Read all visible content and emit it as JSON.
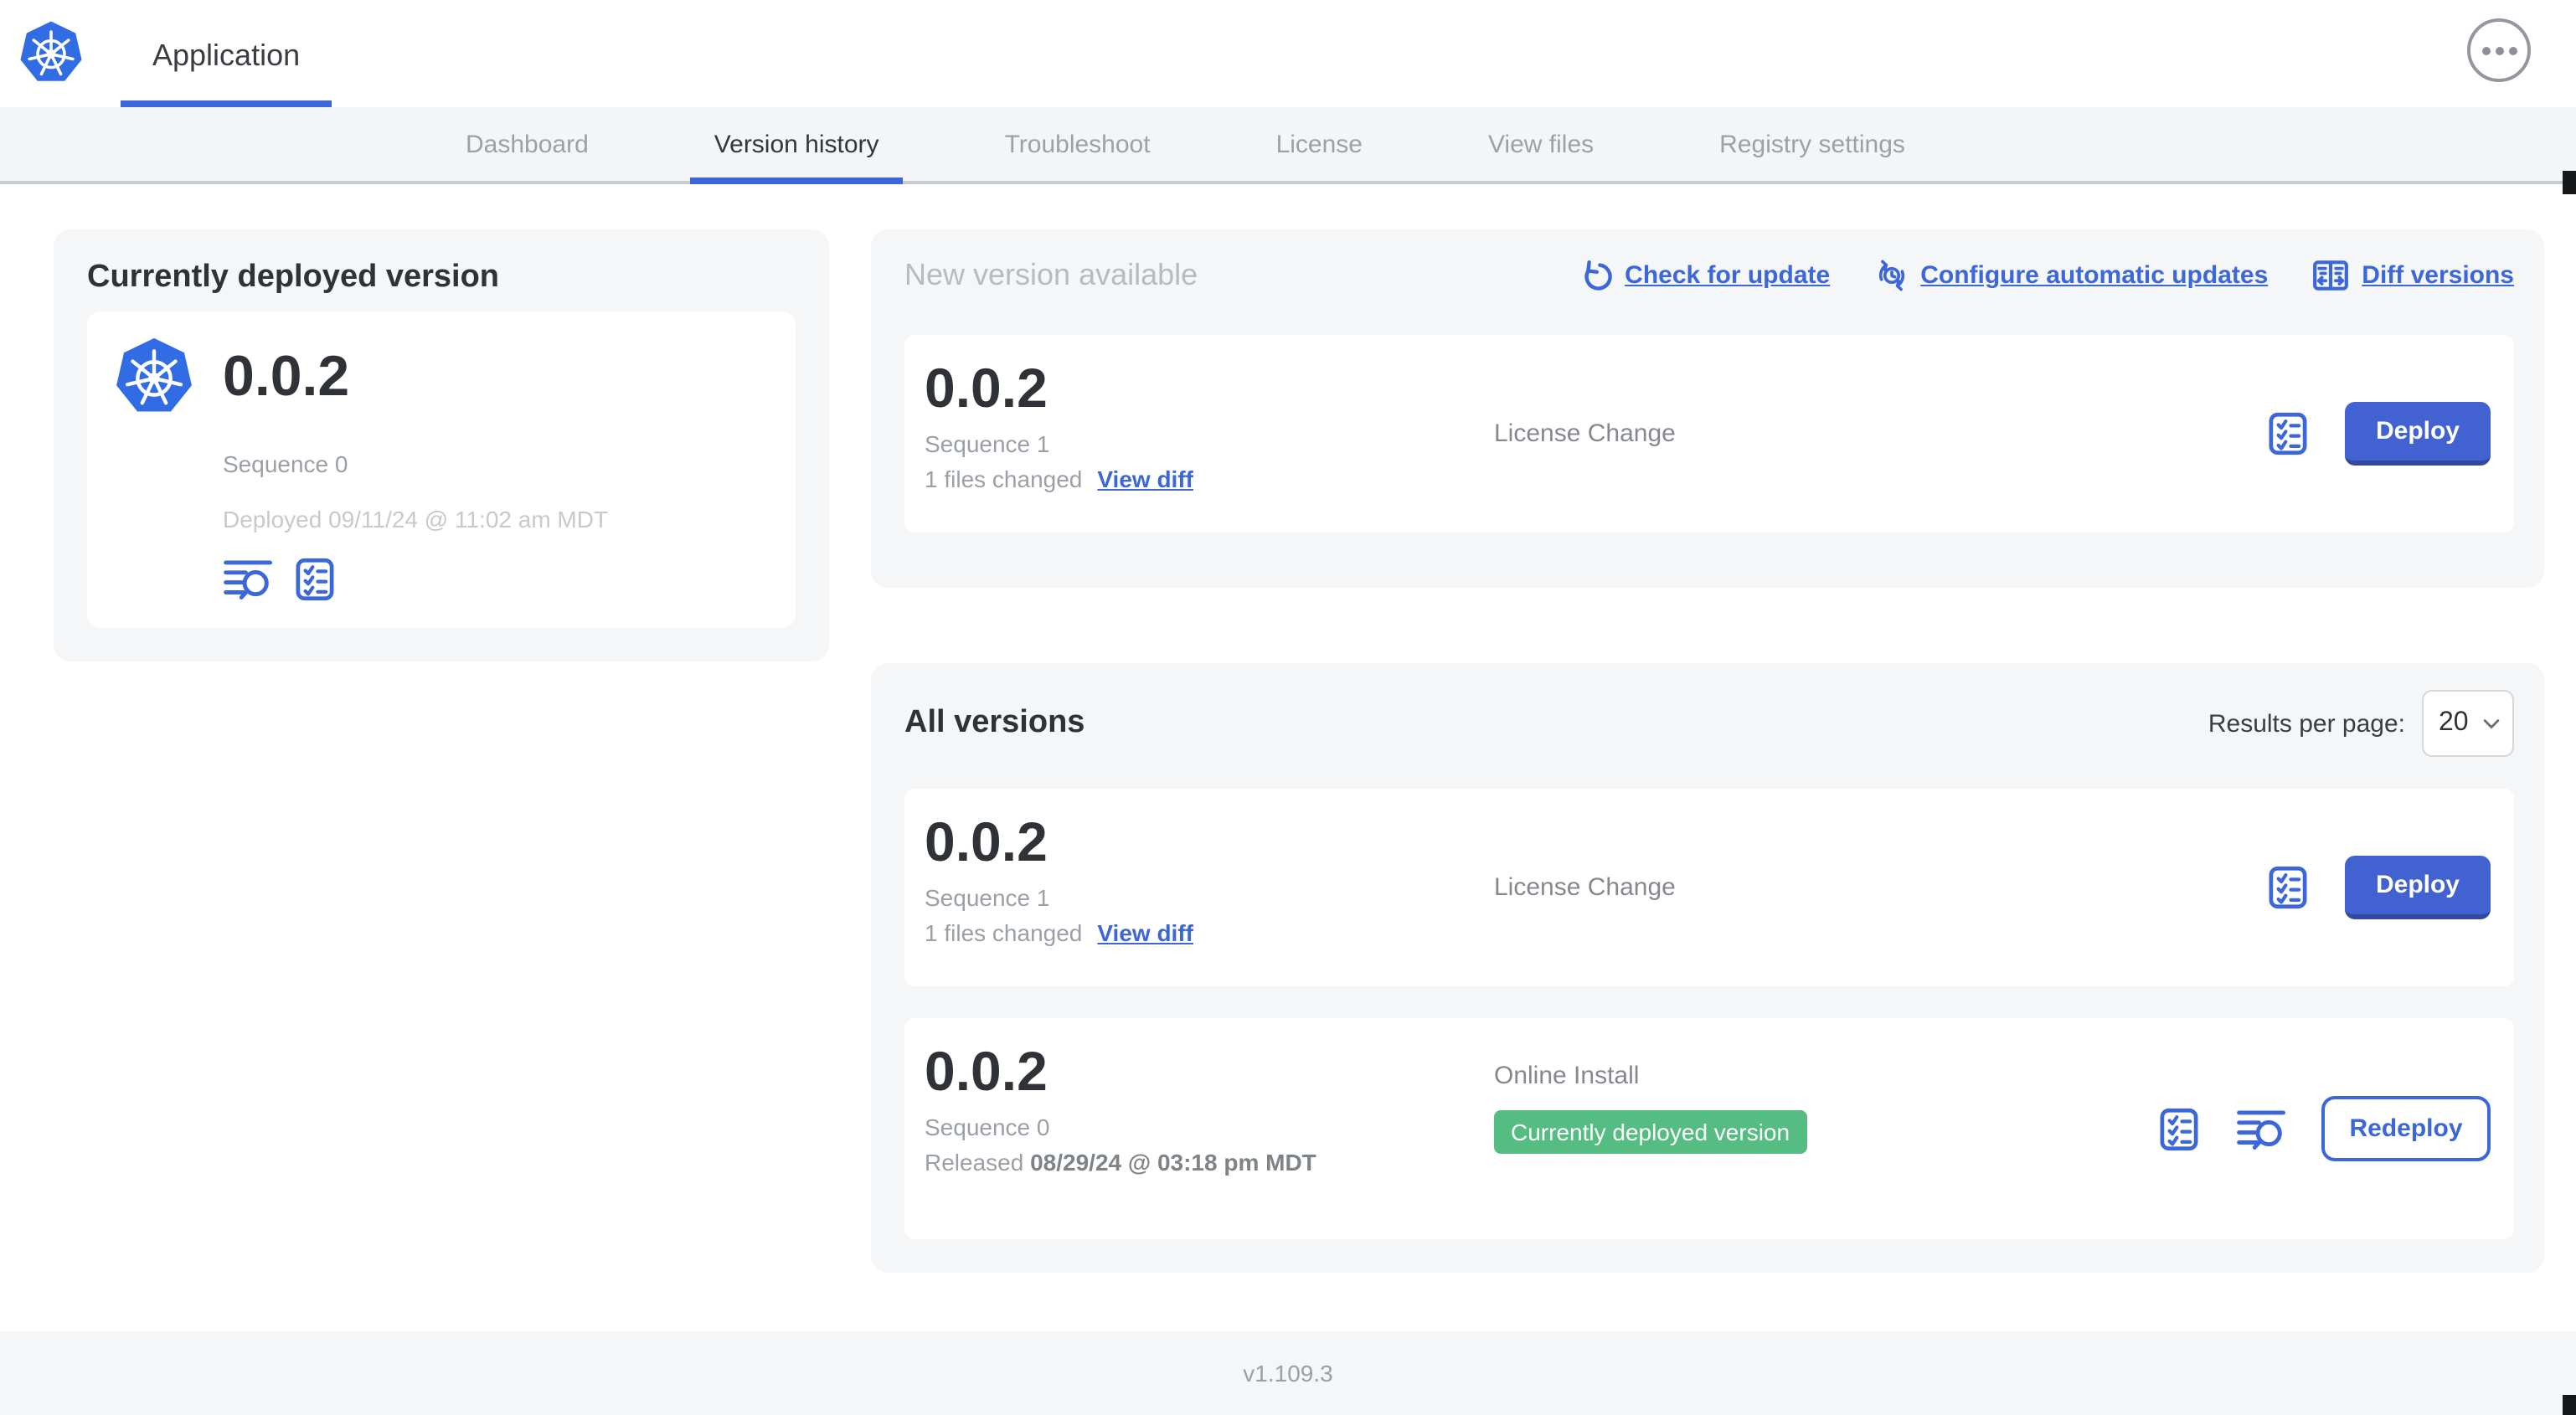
{
  "header": {
    "app_title": "Application"
  },
  "nav": {
    "tabs": [
      {
        "label": "Dashboard"
      },
      {
        "label": "Version history"
      },
      {
        "label": "Troubleshoot"
      },
      {
        "label": "License"
      },
      {
        "label": "View files"
      },
      {
        "label": "Registry settings"
      }
    ]
  },
  "current_version_card": {
    "title": "Currently deployed version",
    "version": "0.0.2",
    "sequence": "Sequence 0",
    "deployed": "Deployed 09/11/24 @ 11:02 am MDT"
  },
  "new_version_section": {
    "title": "New version available",
    "links": [
      {
        "label": "Check for update"
      },
      {
        "label": "Configure automatic updates"
      },
      {
        "label": "Diff versions"
      }
    ],
    "row": {
      "version": "0.0.2",
      "sequence": "Sequence 1",
      "changes": "1 files changed",
      "view_diff_label": "View diff",
      "source": "License Change",
      "action_label": "Deploy"
    }
  },
  "all_versions_section": {
    "title": "All versions",
    "results_per_page_label": "Results per page:",
    "results_per_page_value": "20",
    "rows": [
      {
        "version": "0.0.2",
        "sequence": "Sequence 1",
        "changes": "1 files changed",
        "view_diff_label": "View diff",
        "source": "License Change",
        "action_label": "Deploy"
      },
      {
        "version": "0.0.2",
        "sequence": "Sequence 0",
        "released_prefix": "Released",
        "released_date": "08/29/24 @ 03:18 pm MDT",
        "source": "Online Install",
        "badge": "Currently deployed version",
        "action_label": "Redeploy"
      }
    ]
  },
  "footer": {
    "app_version": "v1.109.3"
  },
  "colors": {
    "kubernetes_blue": "#326ce5",
    "accent_blue": "#3c67d9",
    "button_blue": "#4162d0",
    "badge_green": "#55bd82"
  }
}
